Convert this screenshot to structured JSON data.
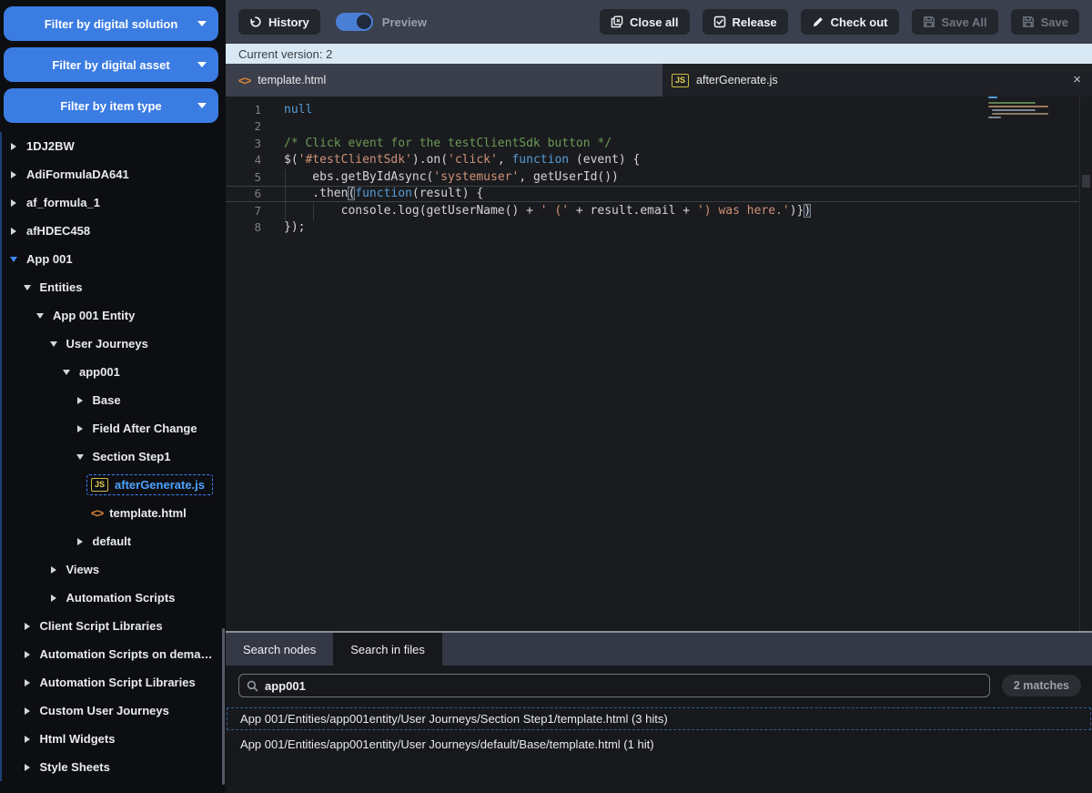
{
  "colors": {
    "accent_blue": "#3b7ce2",
    "selection_blue": "#4da3ff",
    "version_bar_bg": "#d8e9f5"
  },
  "icons": {
    "close": "×",
    "html_glyph": "<>",
    "js_glyph": "JS"
  },
  "sidebar": {
    "filters": [
      "Filter by digital solution",
      "Filter by digital asset",
      "Filter by item type"
    ],
    "tree": [
      {
        "label": "1DJ2BW",
        "level": 0,
        "state": "collapsed"
      },
      {
        "label": "AdiFormulaDA641",
        "level": 0,
        "state": "collapsed"
      },
      {
        "label": "af_formula_1",
        "level": 0,
        "state": "collapsed"
      },
      {
        "label": "afHDEC458",
        "level": 0,
        "state": "collapsed"
      },
      {
        "label": "App 001",
        "level": 0,
        "state": "expanded",
        "accent": true
      },
      {
        "label": "Entities",
        "level": 1,
        "state": "expanded"
      },
      {
        "label": "App 001 Entity",
        "level": 2,
        "state": "expanded"
      },
      {
        "label": "User Journeys",
        "level": 3,
        "state": "expanded"
      },
      {
        "label": "app001",
        "level": 4,
        "state": "expanded"
      },
      {
        "label": "Base",
        "level": 5,
        "state": "collapsed"
      },
      {
        "label": "Field After Change",
        "level": 5,
        "state": "collapsed"
      },
      {
        "label": "Section Step1",
        "level": 5,
        "state": "expanded"
      },
      {
        "label": "afterGenerate.js",
        "level": 6,
        "type": "file",
        "icon": "js",
        "selected": true
      },
      {
        "label": "template.html",
        "level": 6,
        "type": "file",
        "icon": "html"
      },
      {
        "label": "default",
        "level": 5,
        "state": "collapsed"
      },
      {
        "label": "Views",
        "level": 3,
        "state": "collapsed"
      },
      {
        "label": "Automation Scripts",
        "level": 3,
        "state": "collapsed"
      },
      {
        "label": "Client Script Libraries",
        "level": 1,
        "state": "collapsed"
      },
      {
        "label": "Automation Scripts on dema…",
        "level": 1,
        "state": "collapsed"
      },
      {
        "label": "Automation Script Libraries",
        "level": 1,
        "state": "collapsed"
      },
      {
        "label": "Custom User Journeys",
        "level": 1,
        "state": "collapsed"
      },
      {
        "label": "Html Widgets",
        "level": 1,
        "state": "collapsed"
      },
      {
        "label": "Style Sheets",
        "level": 1,
        "state": "collapsed"
      }
    ]
  },
  "toolbar": {
    "history": "History",
    "preview": "Preview",
    "preview_on": true,
    "close_all": "Close all",
    "release": "Release",
    "check_out": "Check out",
    "save_all": "Save All",
    "save": "Save"
  },
  "version_bar": "Current version: 2",
  "tabs": [
    {
      "label": "template.html",
      "icon": "html",
      "active": true
    },
    {
      "label": "afterGenerate.js",
      "icon": "js",
      "active": false
    }
  ],
  "editor": {
    "token_colors": {
      "d": "#d4d4d4",
      "k": "#569cd6",
      "s": "#ce9178",
      "c": "#6a9955",
      "b": "#d4d4d4"
    },
    "lines": [
      {
        "num": 1,
        "tokens": [
          {
            "c": "k",
            "t": "null"
          }
        ]
      },
      {
        "num": 2,
        "tokens": []
      },
      {
        "num": 3,
        "tokens": [
          {
            "c": "c",
            "t": "/* Click event for the testClientSdk button */"
          }
        ]
      },
      {
        "num": 4,
        "tokens": [
          {
            "c": "d",
            "t": "$("
          },
          {
            "c": "s",
            "t": "'#testClientSdk'"
          },
          {
            "c": "d",
            "t": ").on("
          },
          {
            "c": "s",
            "t": "'click'"
          },
          {
            "c": "d",
            "t": ", "
          },
          {
            "c": "k",
            "t": "function"
          },
          {
            "c": "d",
            "t": " (event) {"
          }
        ]
      },
      {
        "num": 5,
        "tokens": [
          {
            "c": "d",
            "t": "    ebs.getByIdAsync("
          },
          {
            "c": "s",
            "t": "'systemuser'"
          },
          {
            "c": "d",
            "t": ", getUserId())"
          }
        ]
      },
      {
        "num": 6,
        "current": true,
        "tokens": [
          {
            "c": "d",
            "t": "    .then"
          },
          {
            "c": "b",
            "t": "("
          },
          {
            "c": "k",
            "t": "function"
          },
          {
            "c": "d",
            "t": "(result) {"
          }
        ]
      },
      {
        "num": 7,
        "tokens": [
          {
            "c": "d",
            "t": "        console.log(getUserName() + "
          },
          {
            "c": "s",
            "t": "' ('"
          },
          {
            "c": "d",
            "t": " + result.email + "
          },
          {
            "c": "s",
            "t": "') was here.'"
          },
          {
            "c": "d",
            "t": ")}"
          },
          {
            "c": "b",
            "t": ")"
          }
        ]
      },
      {
        "num": 8,
        "tokens": [
          {
            "c": "d",
            "t": "});"
          }
        ]
      }
    ]
  },
  "bottom_panel": {
    "tabs": [
      {
        "label": "Search nodes",
        "active": false
      },
      {
        "label": "Search in files",
        "active": true
      }
    ],
    "search_value": "app001",
    "matches_badge": "2 matches",
    "results": [
      {
        "text": "App 001/Entities/app001entity/User Journeys/Section Step1/template.html (3 hits)",
        "selected": true
      },
      {
        "text": "App 001/Entities/app001entity/User Journeys/default/Base/template.html (1 hit)",
        "selected": false
      }
    ]
  }
}
